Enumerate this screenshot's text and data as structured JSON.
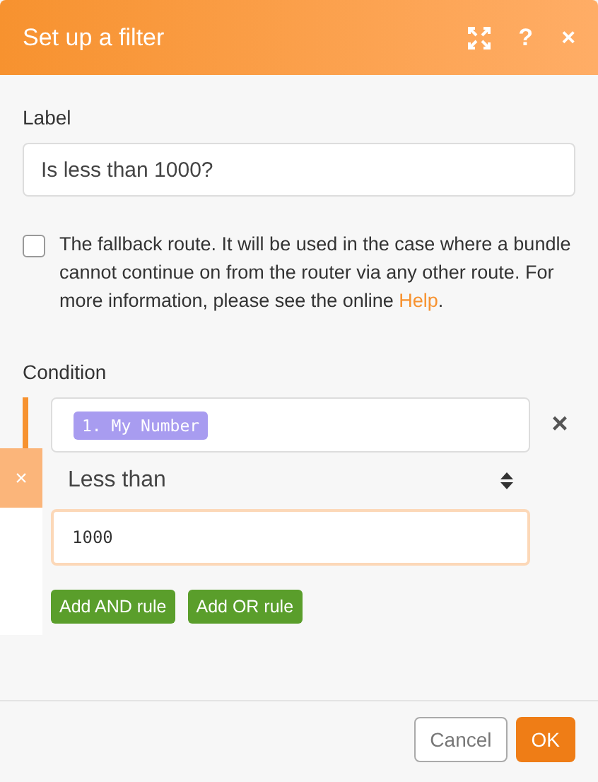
{
  "dialog": {
    "title": "Set up a filter",
    "header_icons": [
      {
        "kind": "expand"
      },
      {
        "kind": "help",
        "glyph": "?"
      },
      {
        "kind": "close",
        "glyph": "×"
      }
    ]
  },
  "label_field": {
    "label": "Label",
    "value": "Is less than 1000?"
  },
  "fallback": {
    "checked": false,
    "text": "The fallback route. It will be used in the case where a bundle cannot continue on from the router via any other route. For more information, please see the online ",
    "link": "Help",
    "after": "."
  },
  "condition": {
    "label": "Condition",
    "side_tab": "×",
    "operand": "1. My Number",
    "remove": "×",
    "operator": "Less than",
    "value": "1000",
    "buttons": [
      "Add AND rule",
      "Add OR rule"
    ]
  },
  "footer": {
    "buttons": [
      {
        "label": "Cancel",
        "kind": "secondary"
      },
      {
        "label": "OK",
        "kind": "primary"
      }
    ]
  }
}
